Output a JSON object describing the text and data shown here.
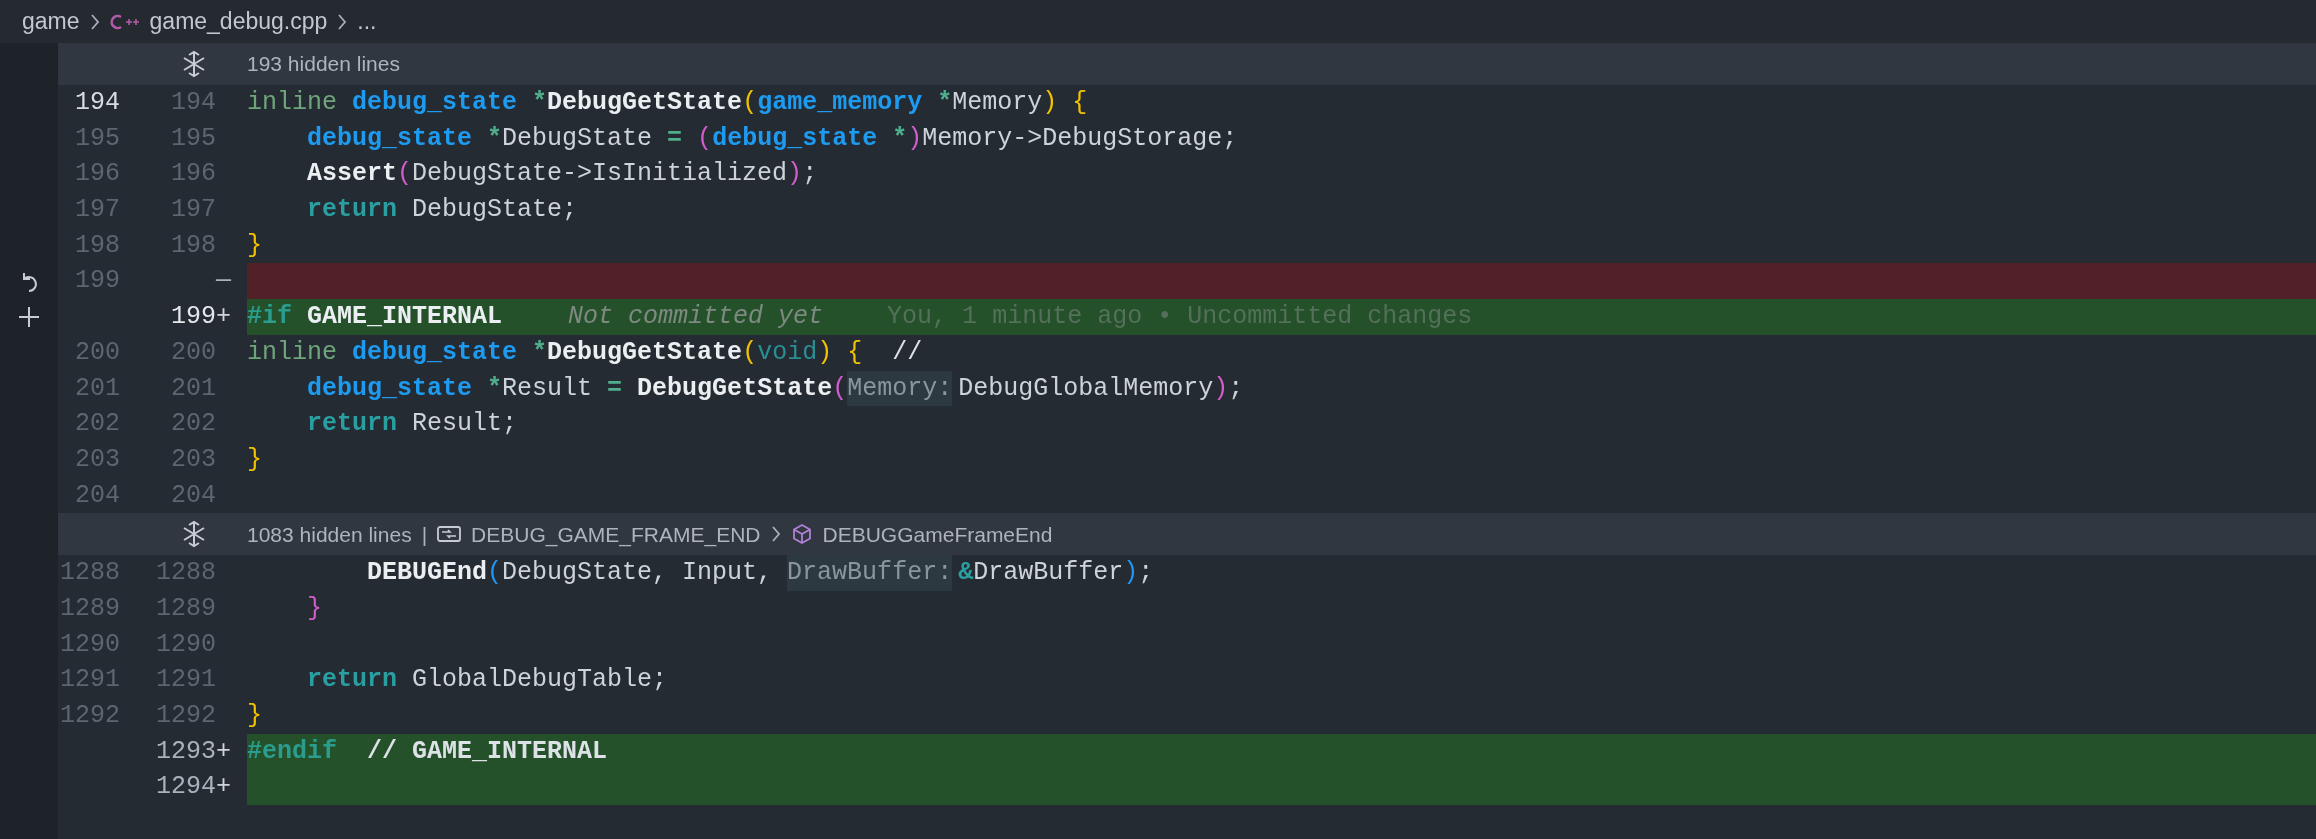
{
  "breadcrumb": [
    {
      "kind": "folder",
      "label": "game"
    },
    {
      "kind": "cpp",
      "label": "game_debug.cpp"
    },
    {
      "kind": "more",
      "label": "..."
    }
  ],
  "sections": [
    {
      "kind": "fold",
      "label": "193 hidden lines"
    },
    {
      "kind": "code",
      "rows": [
        {
          "old": "194",
          "new": "194",
          "kind": "context",
          "current": true,
          "tokens": [
            {
              "kind": "storage",
              "text": "inline "
            },
            {
              "kind": "type",
              "text": "debug_state "
            },
            {
              "kind": "op",
              "text": "*"
            },
            {
              "kind": "func",
              "text": "DebugGetState"
            },
            {
              "kind": "bracket1",
              "text": "("
            },
            {
              "kind": "type",
              "text": "game_memory "
            },
            {
              "kind": "op",
              "text": "*"
            },
            {
              "kind": "plain",
              "text": "Memory"
            },
            {
              "kind": "bracket1",
              "text": ") {"
            }
          ]
        },
        {
          "old": "195",
          "new": "195",
          "kind": "context",
          "tokens": [
            {
              "kind": "type",
              "text": "    debug_state "
            },
            {
              "kind": "op",
              "text": "*"
            },
            {
              "kind": "plain",
              "text": "DebugState "
            },
            {
              "kind": "op",
              "text": "= "
            },
            {
              "kind": "bracket2",
              "text": "("
            },
            {
              "kind": "type",
              "text": "debug_state "
            },
            {
              "kind": "op",
              "text": "*"
            },
            {
              "kind": "bracket2",
              "text": ")"
            },
            {
              "kind": "plain",
              "text": "Memory->DebugStorage;"
            }
          ]
        },
        {
          "old": "196",
          "new": "196",
          "kind": "context",
          "tokens": [
            {
              "kind": "func",
              "text": "    Assert"
            },
            {
              "kind": "bracket2",
              "text": "("
            },
            {
              "kind": "plain",
              "text": "DebugState->IsInitialized"
            },
            {
              "kind": "bracket2",
              "text": ")"
            },
            {
              "kind": "plain",
              "text": ";"
            }
          ]
        },
        {
          "old": "197",
          "new": "197",
          "kind": "context",
          "tokens": [
            {
              "kind": "keyword",
              "text": "    return"
            },
            {
              "kind": "plain",
              "text": " DebugState;"
            }
          ]
        },
        {
          "old": "198",
          "new": "198",
          "kind": "context",
          "tokens": [
            {
              "kind": "bracket1",
              "text": "}"
            }
          ]
        },
        {
          "old": "199",
          "marker": "—",
          "kind": "deleted",
          "revertible": true,
          "tokens": []
        },
        {
          "new": "199",
          "marker": "+",
          "kind": "added",
          "current": true,
          "stageable": true,
          "tokens": [
            {
              "kind": "preproc",
              "text": "#if "
            },
            {
              "kind": "macro",
              "text": "GAME_INTERNAL"
            }
          ],
          "blame": {
            "status": "Not committed yet",
            "detail": "You, 1 minute ago • Uncommitted changes"
          }
        },
        {
          "old": "200",
          "new": "200",
          "kind": "context",
          "tokens": [
            {
              "kind": "storage",
              "text": "inline "
            },
            {
              "kind": "type",
              "text": "debug_state "
            },
            {
              "kind": "op",
              "text": "*"
            },
            {
              "kind": "func",
              "text": "DebugGetState"
            },
            {
              "kind": "bracket1",
              "text": "("
            },
            {
              "kind": "void",
              "text": "void"
            },
            {
              "kind": "bracket1",
              "text": ") {"
            },
            {
              "kind": "comment",
              "text": "  //"
            }
          ]
        },
        {
          "old": "201",
          "new": "201",
          "kind": "context",
          "tokens": [
            {
              "kind": "type",
              "text": "    debug_state "
            },
            {
              "kind": "op",
              "text": "*"
            },
            {
              "kind": "plain",
              "text": "Result "
            },
            {
              "kind": "op",
              "text": "= "
            },
            {
              "kind": "func",
              "text": "DebugGetState"
            },
            {
              "kind": "bracket2",
              "text": "("
            },
            {
              "kind": "hint",
              "text": "Memory:"
            },
            {
              "kind": "plain",
              "text": "DebugGlobalMemory"
            },
            {
              "kind": "bracket2",
              "text": ")"
            },
            {
              "kind": "plain",
              "text": ";"
            }
          ]
        },
        {
          "old": "202",
          "new": "202",
          "kind": "context",
          "tokens": [
            {
              "kind": "keyword",
              "text": "    return"
            },
            {
              "kind": "plain",
              "text": " Result;"
            }
          ]
        },
        {
          "old": "203",
          "new": "203",
          "kind": "context",
          "tokens": [
            {
              "kind": "bracket1",
              "text": "}"
            }
          ]
        },
        {
          "old": "204",
          "new": "204",
          "kind": "context",
          "tokens": []
        }
      ]
    },
    {
      "kind": "fold",
      "label": "1083 hidden lines",
      "separator": "|",
      "path": [
        {
          "kind": "field",
          "label": "DEBUG_GAME_FRAME_END"
        },
        {
          "kind": "method",
          "label": "DEBUGGameFrameEnd"
        }
      ]
    },
    {
      "kind": "code",
      "rows": [
        {
          "old": "1288",
          "new": "1288",
          "kind": "context",
          "tokens": [
            {
              "kind": "func",
              "text": "        DEBUGEnd"
            },
            {
              "kind": "bracket3",
              "text": "("
            },
            {
              "kind": "plain",
              "text": "DebugState, Input, "
            },
            {
              "kind": "hint",
              "text": "DrawBuffer:"
            },
            {
              "kind": "amp",
              "text": "&"
            },
            {
              "kind": "plain",
              "text": "DrawBuffer"
            },
            {
              "kind": "bracket3",
              "text": ")"
            },
            {
              "kind": "plain",
              "text": ";"
            }
          ]
        },
        {
          "old": "1289",
          "new": "1289",
          "kind": "context",
          "tokens": [
            {
              "kind": "bracket2",
              "text": "    }"
            }
          ]
        },
        {
          "old": "1290",
          "new": "1290",
          "kind": "context",
          "tokens": []
        },
        {
          "old": "1291",
          "new": "1291",
          "kind": "context",
          "tokens": [
            {
              "kind": "keyword",
              "text": "    return"
            },
            {
              "kind": "plain",
              "text": " GlobalDebugTable;"
            }
          ]
        },
        {
          "old": "1292",
          "new": "1292",
          "kind": "context",
          "tokens": [
            {
              "kind": "bracket1",
              "text": "}"
            }
          ]
        },
        {
          "new": "1293",
          "marker": "+",
          "kind": "added",
          "tokens": [
            {
              "kind": "preproc",
              "text": "#endif  "
            },
            {
              "kind": "comment_bold",
              "text": "// GAME_INTERNAL"
            }
          ]
        },
        {
          "new": "1294",
          "marker": "+",
          "kind": "added",
          "tokens": []
        }
      ]
    }
  ]
}
